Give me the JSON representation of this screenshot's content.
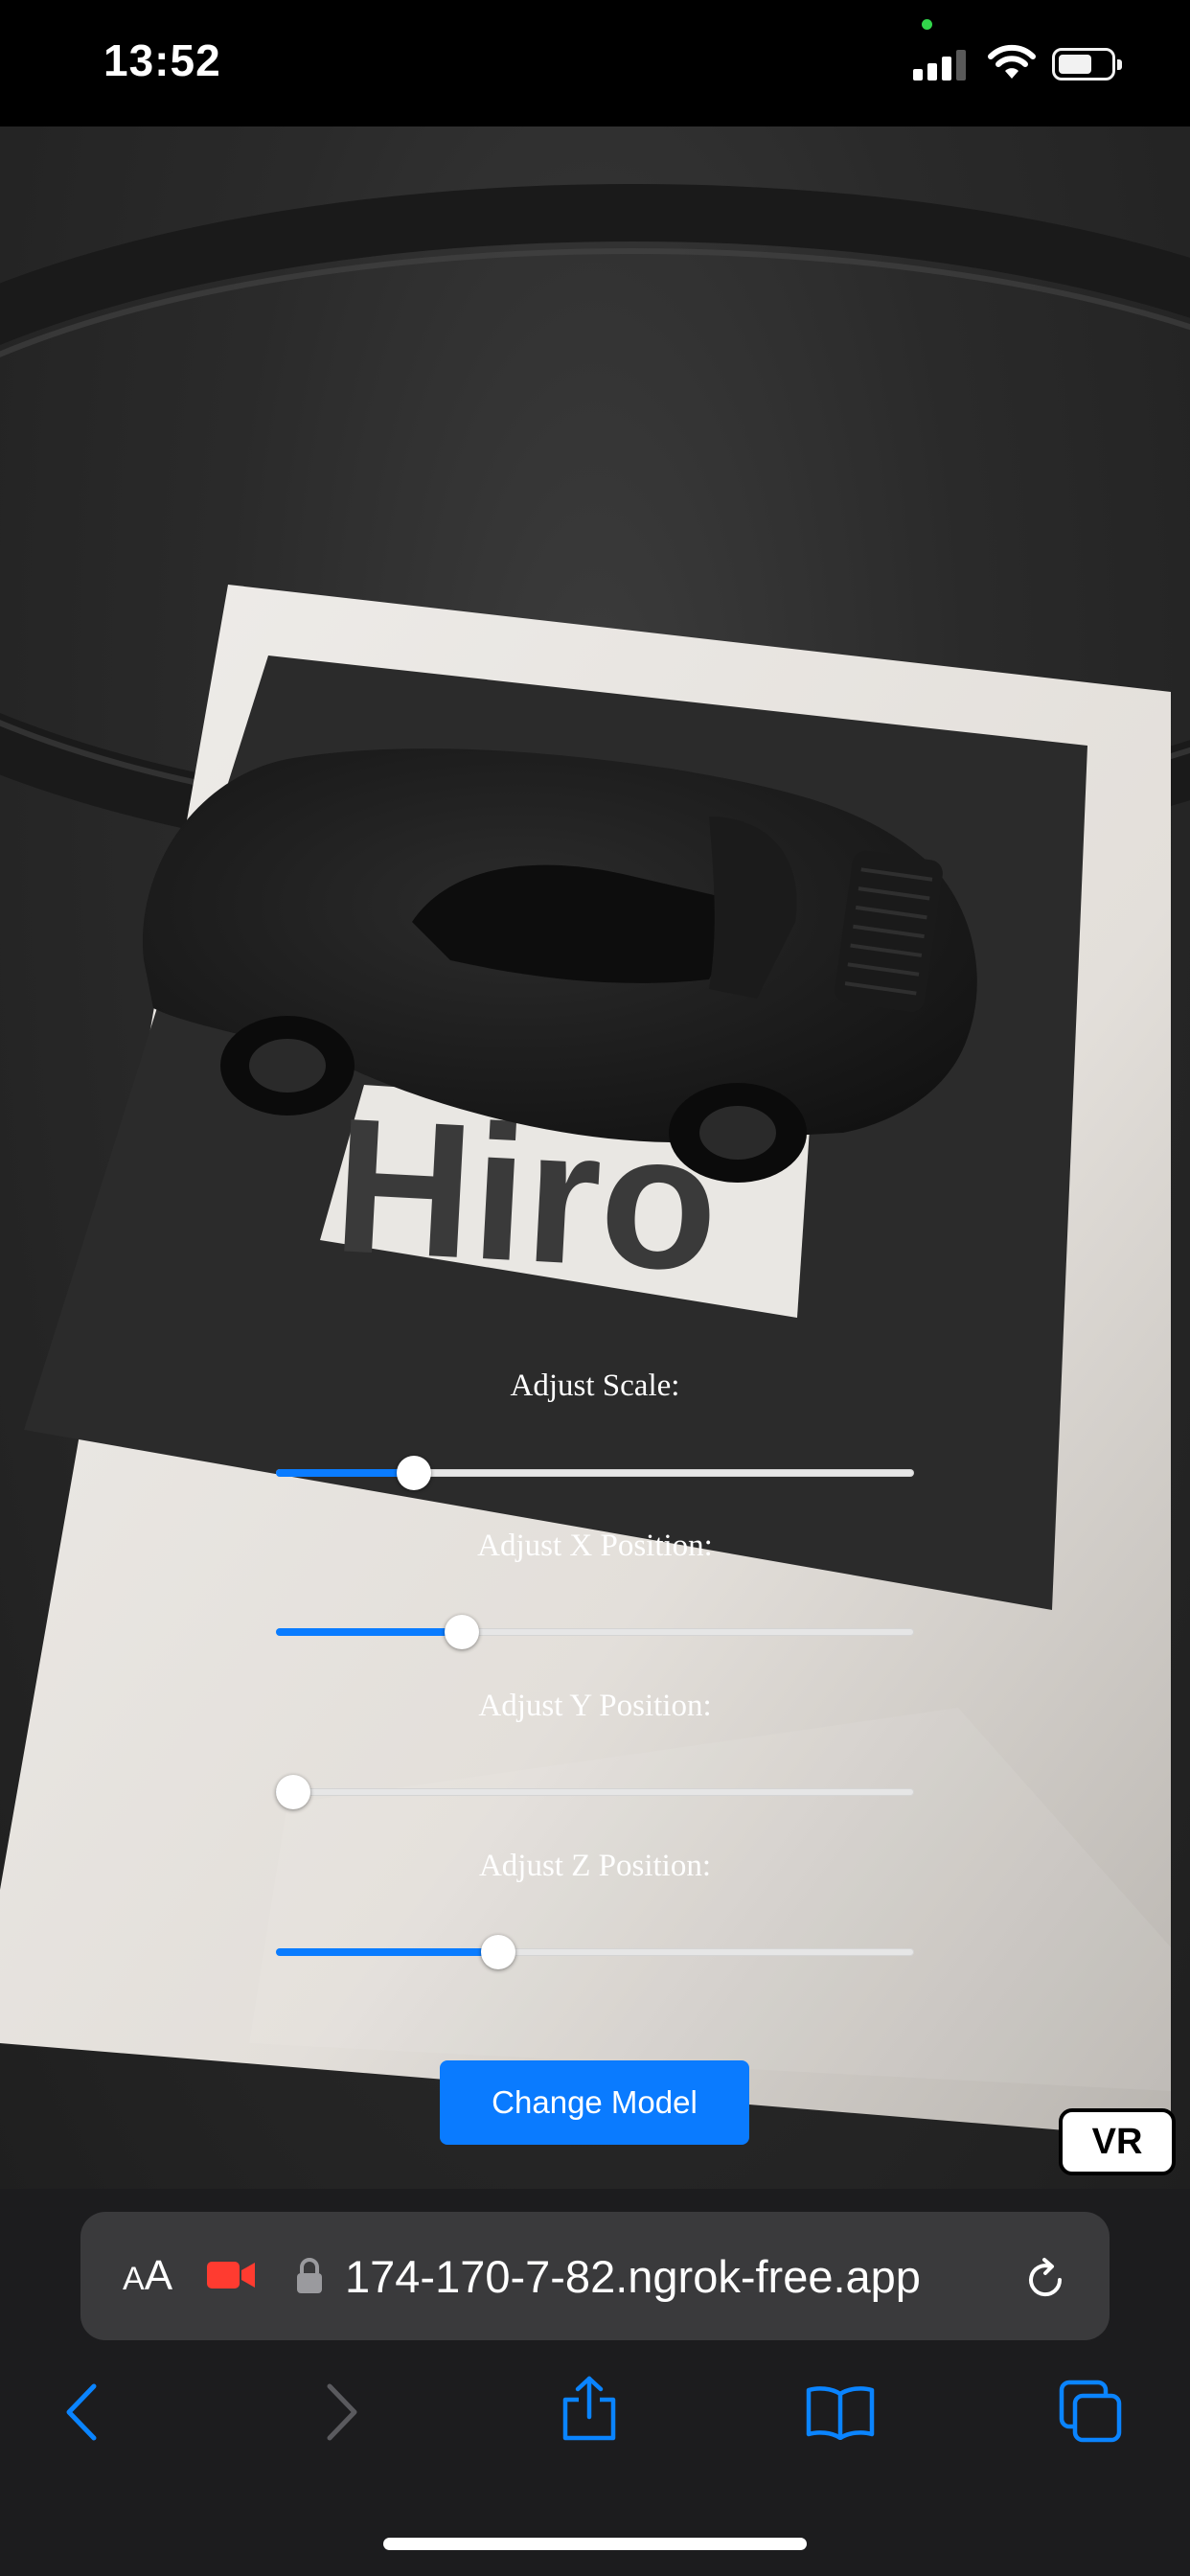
{
  "status_bar": {
    "time": "13:52",
    "icons": [
      "camera-in-use-dot",
      "signal-icon",
      "wifi-icon",
      "battery-icon"
    ]
  },
  "scene": {
    "marker_text": "Hiro",
    "model": "black car (3D model)"
  },
  "controls": {
    "sliders": [
      {
        "label": "Adjust Scale:",
        "value": 0.2
      },
      {
        "label": "Adjust X Position:",
        "value": 0.28
      },
      {
        "label": "Adjust Y Position:",
        "value": 0.0
      },
      {
        "label": "Adjust Z Position:",
        "value": 0.34
      }
    ],
    "change_model_label": "Change Model",
    "vr_label": "VR",
    "accent_color": "#0a7cff"
  },
  "browser": {
    "aa_small": "A",
    "aa_large": "A",
    "url": "174-170-7-82.ngrok-free.app",
    "toolbar": [
      "back-icon",
      "forward-icon",
      "share-icon",
      "bookmarks-icon",
      "tabs-icon"
    ],
    "accent_color": "#0a84ff"
  }
}
